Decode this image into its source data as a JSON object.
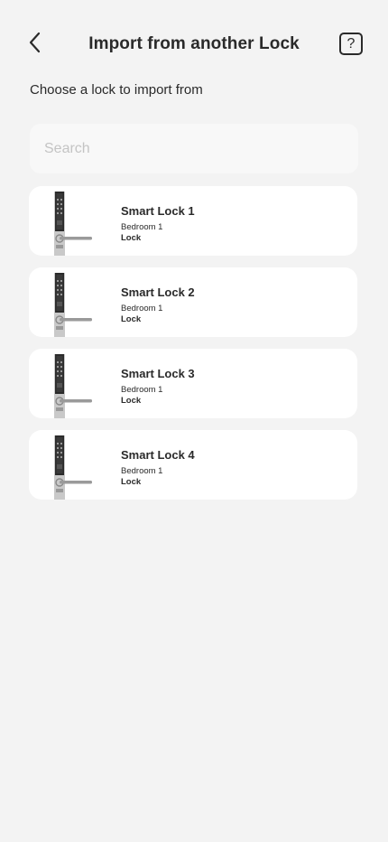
{
  "header": {
    "back_icon": "chevron-left-icon",
    "title": "Import from another Lock",
    "help_icon": "question-mark-icon",
    "help_label": "?"
  },
  "subtitle": "Choose a lock to import from",
  "search": {
    "placeholder": "Search",
    "value": ""
  },
  "locks": [
    {
      "name": "Smart Lock 1",
      "room": "Bedroom 1",
      "type": "Lock",
      "icon": "smart-lock-image"
    },
    {
      "name": "Smart Lock 2",
      "room": "Bedroom 1",
      "type": "Lock",
      "icon": "smart-lock-image"
    },
    {
      "name": "Smart Lock 3",
      "room": "Bedroom 1",
      "type": "Lock",
      "icon": "smart-lock-image"
    },
    {
      "name": "Smart Lock 4",
      "room": "Bedroom 1",
      "type": "Lock",
      "icon": "smart-lock-image"
    }
  ]
}
